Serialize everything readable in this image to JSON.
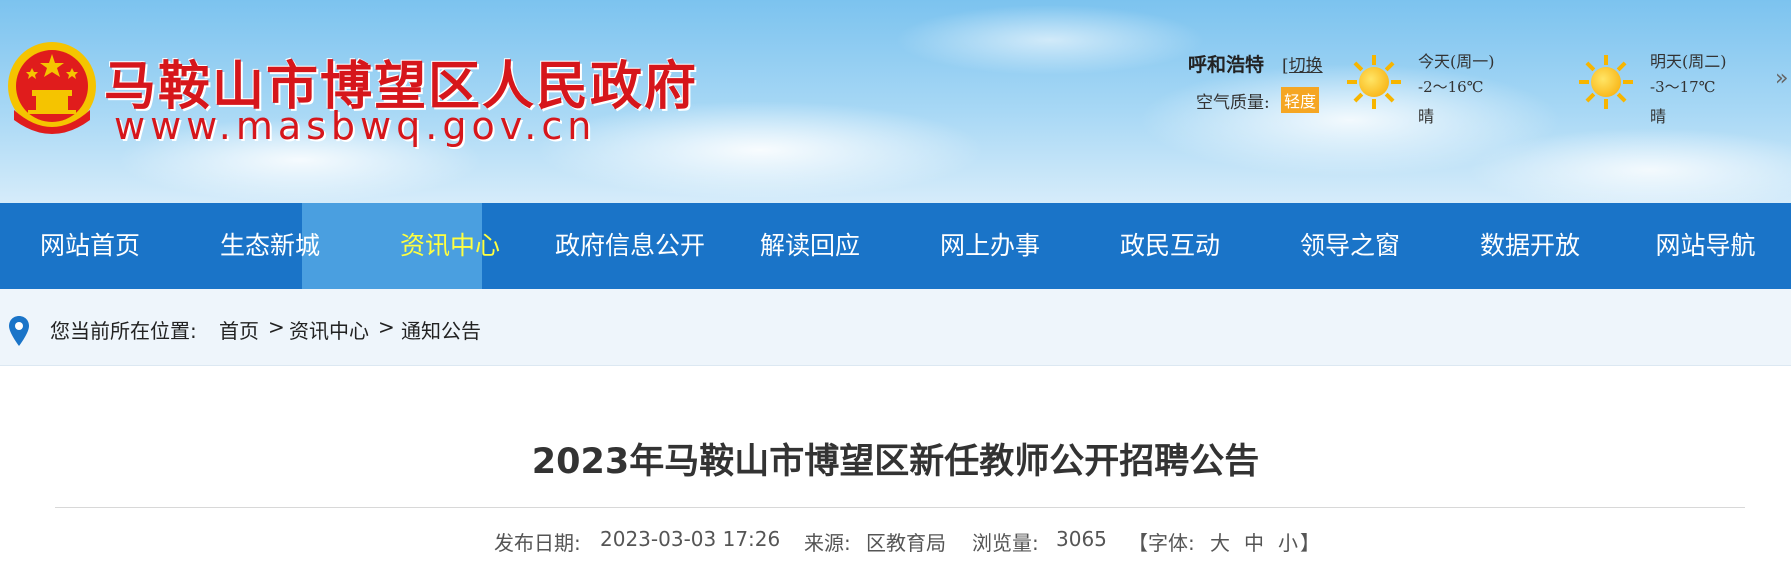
{
  "header": {
    "site_title": "马鞍山市博望区人民政府",
    "site_url": "www.masbwq.gov.cn",
    "emblem_icon": "national-emblem-icon"
  },
  "weather": {
    "city": "呼和浩特",
    "switch_label": "[切换",
    "air_quality_label": "空气质量:",
    "air_quality_value": "轻度",
    "more_icon": "double-chevron-right-icon",
    "days": [
      {
        "day": "今天(周一)",
        "temp": "-2～16℃",
        "condition": "晴",
        "icon": "sun-icon"
      },
      {
        "day": "明天(周二)",
        "temp": "-3～17℃",
        "condition": "晴",
        "icon": "sun-icon"
      }
    ]
  },
  "nav": {
    "items": [
      "网站首页",
      "生态新城",
      "资讯中心",
      "政府信息公开",
      "解读回应",
      "网上办事",
      "政民互动",
      "领导之窗",
      "数据开放",
      "网站导航"
    ],
    "active": "资讯中心"
  },
  "breadcrumb": {
    "icon": "location-pin-icon",
    "prefix": "您当前所在位置:",
    "items": [
      "首页",
      "资讯中心",
      "通知公告"
    ],
    "separator": ">"
  },
  "article": {
    "title": "2023年马鞍山市博望区新任教师公开招聘公告",
    "publish_label": "发布日期:",
    "publish_date": "2023-03-03 17:26",
    "source_label": "来源:",
    "source": "区教育局",
    "views_label": "浏览量:",
    "views": "3065",
    "font_size_open": "【字体:",
    "font_large": "大",
    "font_medium": "中",
    "font_small": "小",
    "font_size_close": "】"
  },
  "colors": {
    "nav_bg": "#1a74c8",
    "nav_active_text": "#ffff40",
    "title_red": "#d6161b"
  }
}
